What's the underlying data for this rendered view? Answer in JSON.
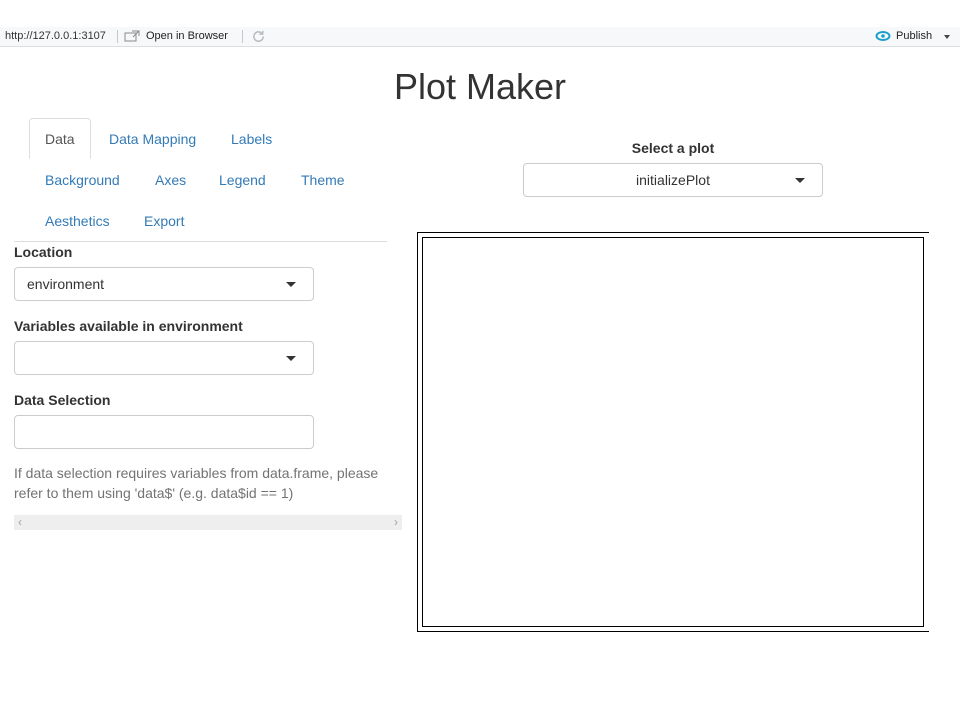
{
  "browser": {
    "url": "http://127.0.0.1:3107",
    "open_in_browser": "Open in Browser",
    "publish": "Publish"
  },
  "app": {
    "title": "Plot Maker"
  },
  "tabs": [
    {
      "label": "Data",
      "active": true
    },
    {
      "label": "Data Mapping"
    },
    {
      "label": "Labels"
    },
    {
      "label": "Background"
    },
    {
      "label": "Axes"
    },
    {
      "label": "Legend"
    },
    {
      "label": "Theme"
    },
    {
      "label": "Aesthetics"
    },
    {
      "label": "Export"
    }
  ],
  "data_panel": {
    "location_label": "Location",
    "location_value": "environment",
    "variables_label": "Variables available in environment",
    "variables_value": "",
    "selection_label": "Data Selection",
    "selection_value": "",
    "help_text": "If data selection requires variables from data.frame, please refer to them using 'data$' (e.g. data$id == 1)"
  },
  "plot_select": {
    "label": "Select a plot",
    "value": "initializePlot"
  },
  "colors": {
    "link": "#337ab7",
    "publish_icon": "#1a9fc9"
  },
  "icons": {
    "open_in_browser": "open-window-icon",
    "refresh": "refresh-icon",
    "publish": "publish-icon",
    "scroll_left": "chevron-left-icon",
    "scroll_right": "chevron-right-icon"
  }
}
